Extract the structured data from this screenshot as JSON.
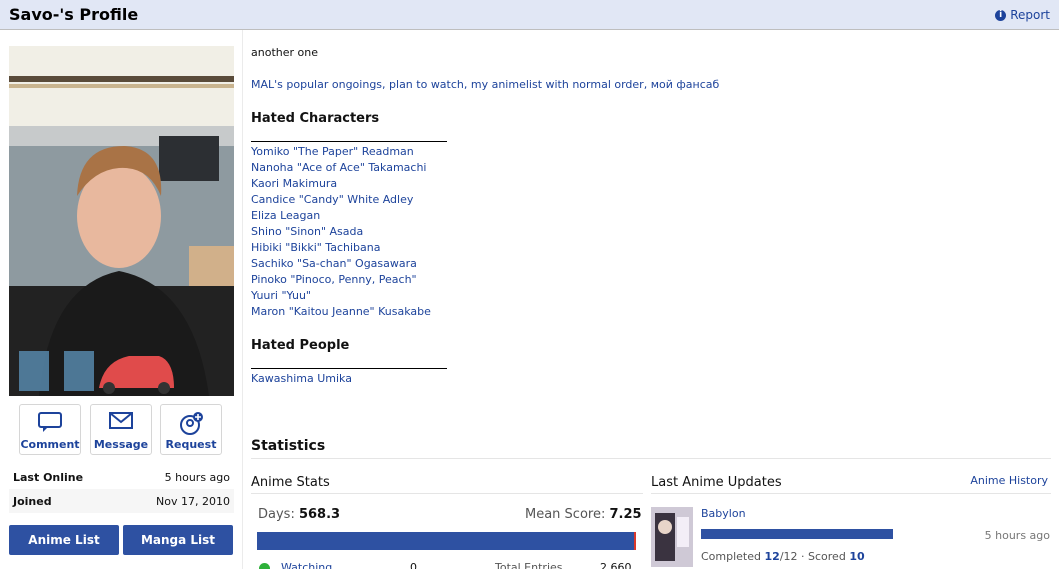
{
  "header": {
    "title": "Savo-'s Profile",
    "report_label": "Report"
  },
  "actions": {
    "comment": "Comment",
    "message": "Message",
    "request": "Request"
  },
  "info": [
    {
      "key": "Last Online",
      "value": "5 hours ago"
    },
    {
      "key": "Joined",
      "value": "Nov 17, 2010"
    }
  ],
  "lists": {
    "anime": "Anime List",
    "manga": "Manga List"
  },
  "about": {
    "line1": "another one",
    "links": "MAL's popular ongoings, plan to watch, my animelist with normal order, мой фансаб",
    "hated_characters_title": "Hated Characters",
    "hated_characters": [
      "Yomiko \"The Paper\" Readman",
      "Nanoha \"Ace of Ace\" Takamachi",
      "Kaori Makimura",
      "Candice \"Candy\" White Adley",
      "Eliza Leagan",
      "Shino \"Sinon\" Asada",
      "Hibiki \"Bikki\" Tachibana",
      "Sachiko \"Sa-chan\" Ogasawara",
      "Pinoko \"Pinoco, Penny, Peach\"",
      "Yuuri \"Yuu\"",
      "Maron \"Kaitou Jeanne\" Kusakabe"
    ],
    "hated_people_title": "Hated People",
    "hated_people": [
      "Kawashima Umika"
    ]
  },
  "stats": {
    "title": "Statistics",
    "anime_stats_title": "Anime Stats",
    "days_label": "Days:",
    "days_value": "568.3",
    "mean_label": "Mean Score:",
    "mean_value": "7.25",
    "watching_label": "Watching",
    "watching_value": "0",
    "total_label": "Total Entries",
    "total_value": "2,660"
  },
  "updates": {
    "title": "Last Anime Updates",
    "history_label": "Anime History",
    "item_title": "Babylon",
    "item_time": "5 hours ago",
    "status": "Completed",
    "progress": "12",
    "total": "/12",
    "scored_label": "· Scored",
    "score": "10"
  }
}
